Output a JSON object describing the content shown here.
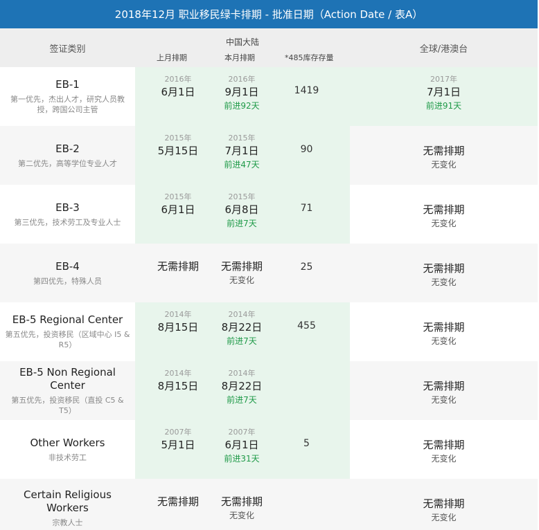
{
  "title": "2018年12月 职业移民绿卡排期 - 批准日期（Action Date / 表A）",
  "header": {
    "category": "签证类别",
    "mainland": "中国大陆",
    "last_month": "上月排期",
    "this_month": "本月排期",
    "inventory": "*485库存存量",
    "global": "全球/港澳台"
  },
  "rows": [
    {
      "name": "EB-1",
      "desc": "第一优先，杰出人才，研究人员教授，跨国公司主管",
      "prev_year": "2016年",
      "prev_date": "6月1日",
      "curr_year": "2016年",
      "curr_date": "9月1日",
      "curr_change": "前进92天",
      "inventory": "1419",
      "g_year": "2017年",
      "g_date": "7月1日",
      "g_change": "前进91天"
    },
    {
      "name": "EB-2",
      "desc": "第二优先，高等学位专业人才",
      "prev_year": "2015年",
      "prev_date": "5月15日",
      "curr_year": "2015年",
      "curr_date": "7月1日",
      "curr_change": "前进47天",
      "inventory": "90",
      "g_date": "无需排期",
      "g_change": "无变化"
    },
    {
      "name": "EB-3",
      "desc": "第三优先，技术劳工及专业人士",
      "prev_year": "2015年",
      "prev_date": "6月1日",
      "curr_year": "2015年",
      "curr_date": "6月8日",
      "curr_change": "前进7天",
      "inventory": "71",
      "g_date": "无需排期",
      "g_change": "无变化"
    },
    {
      "name": "EB-4",
      "desc": "第四优先，特殊人员",
      "prev_date": "无需排期",
      "curr_date": "无需排期",
      "curr_change": "无变化",
      "inventory": "25",
      "g_date": "无需排期",
      "g_change": "无变化"
    },
    {
      "name": "EB-5 Regional Center",
      "desc": "第五优先，投资移民（区域中心 I5 & R5）",
      "prev_year": "2014年",
      "prev_date": "8月15日",
      "curr_year": "2014年",
      "curr_date": "8月22日",
      "curr_change": "前进7天",
      "inventory": "455",
      "g_date": "无需排期",
      "g_change": "无变化"
    },
    {
      "name": "EB-5 Non Regional Center",
      "desc": "第五优先，投资移民（直投 C5 & T5）",
      "prev_year": "2014年",
      "prev_date": "8月15日",
      "curr_year": "2014年",
      "curr_date": "8月22日",
      "curr_change": "前进7天",
      "inventory": "",
      "g_date": "无需排期",
      "g_change": "无变化"
    },
    {
      "name": "Other Workers",
      "desc": "非技术劳工",
      "prev_year": "2007年",
      "prev_date": "5月1日",
      "curr_year": "2007年",
      "curr_date": "6月1日",
      "curr_change": "前进31天",
      "inventory": "5",
      "g_date": "无需排期",
      "g_change": "无变化"
    },
    {
      "name": "Certain Religious Workers",
      "desc": "宗教人士",
      "prev_date": "无需排期",
      "curr_date": "无需排期",
      "curr_change": "无变化",
      "inventory": "",
      "g_date": "无需排期",
      "g_change": "无变化"
    }
  ]
}
